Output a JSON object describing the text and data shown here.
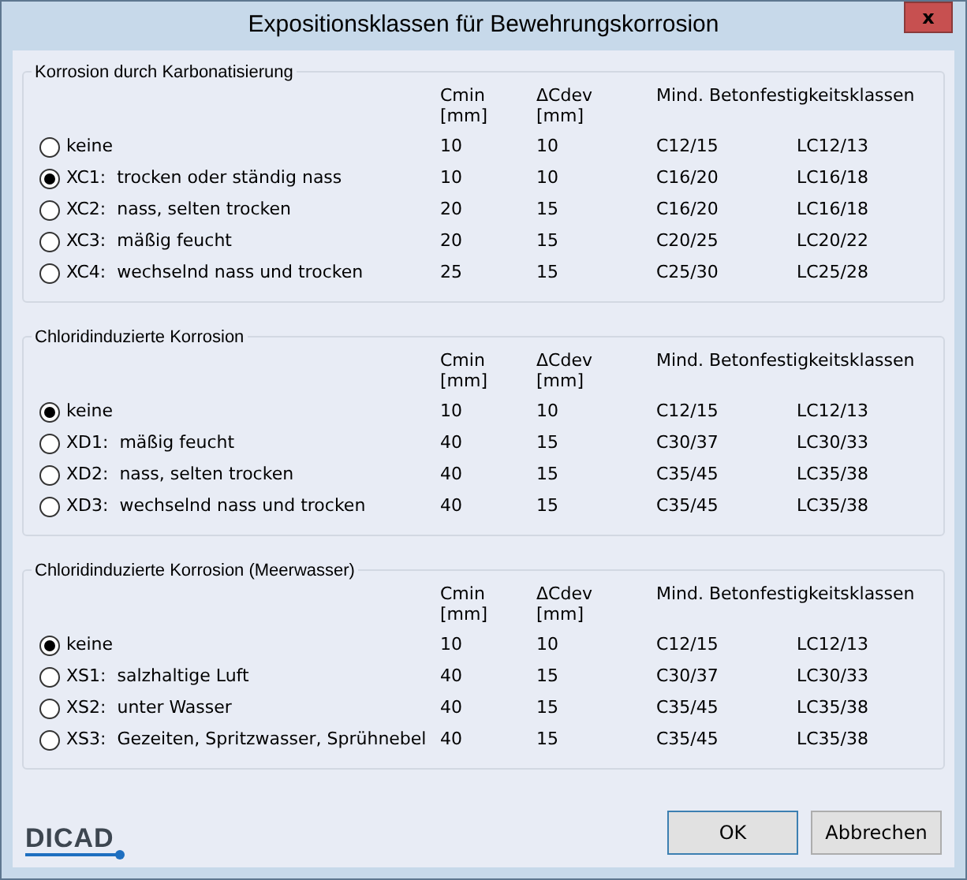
{
  "window": {
    "title": "Expositionsklassen für Bewehrungskorrosion",
    "close": "x"
  },
  "groups": [
    {
      "title": "Korrosion durch Karbonatisierung",
      "columns": [
        {
          "label": "Cmin",
          "unit": "[mm]"
        },
        {
          "label": "ΔCdev",
          "unit": "[mm]"
        },
        {
          "label": "Mind. Betonfestigkeitsklassen"
        }
      ],
      "rows": [
        {
          "label": "keine",
          "selected": false,
          "cmin": "10",
          "dcdev": "10",
          "c_class": "C12/15",
          "lc_class": "LC12/13"
        },
        {
          "label": "XC1:  trocken oder ständig nass",
          "selected": true,
          "cmin": "10",
          "dcdev": "10",
          "c_class": "C16/20",
          "lc_class": "LC16/18"
        },
        {
          "label": "XC2:  nass, selten trocken",
          "selected": false,
          "cmin": "20",
          "dcdev": "15",
          "c_class": "C16/20",
          "lc_class": "LC16/18"
        },
        {
          "label": "XC3:  mäßig feucht",
          "selected": false,
          "cmin": "20",
          "dcdev": "15",
          "c_class": "C20/25",
          "lc_class": "LC20/22"
        },
        {
          "label": "XC4:  wechselnd nass und trocken",
          "selected": false,
          "cmin": "25",
          "dcdev": "15",
          "c_class": "C25/30",
          "lc_class": "LC25/28"
        }
      ]
    },
    {
      "title": "Chloridinduzierte Korrosion",
      "columns": [
        {
          "label": "Cmin",
          "unit": "[mm]"
        },
        {
          "label": "ΔCdev",
          "unit": "[mm]"
        },
        {
          "label": "Mind. Betonfestigkeitsklassen"
        }
      ],
      "rows": [
        {
          "label": "keine",
          "selected": true,
          "cmin": "10",
          "dcdev": "10",
          "c_class": "C12/15",
          "lc_class": "LC12/13"
        },
        {
          "label": "XD1:  mäßig feucht",
          "selected": false,
          "cmin": "40",
          "dcdev": "15",
          "c_class": "C30/37",
          "lc_class": "LC30/33"
        },
        {
          "label": "XD2:  nass, selten trocken",
          "selected": false,
          "cmin": "40",
          "dcdev": "15",
          "c_class": "C35/45",
          "lc_class": "LC35/38"
        },
        {
          "label": "XD3:  wechselnd nass und trocken",
          "selected": false,
          "cmin": "40",
          "dcdev": "15",
          "c_class": "C35/45",
          "lc_class": "LC35/38"
        }
      ]
    },
    {
      "title": "Chloridinduzierte Korrosion (Meerwasser)",
      "columns": [
        {
          "label": "Cmin",
          "unit": "[mm]"
        },
        {
          "label": "ΔCdev",
          "unit": "[mm]"
        },
        {
          "label": "Mind. Betonfestigkeitsklassen"
        }
      ],
      "rows": [
        {
          "label": "keine",
          "selected": true,
          "cmin": "10",
          "dcdev": "10",
          "c_class": "C12/15",
          "lc_class": "LC12/13"
        },
        {
          "label": "XS1:  salzhaltige Luft",
          "selected": false,
          "cmin": "40",
          "dcdev": "15",
          "c_class": "C30/37",
          "lc_class": "LC30/33"
        },
        {
          "label": "XS2:  unter Wasser",
          "selected": false,
          "cmin": "40",
          "dcdev": "15",
          "c_class": "C35/45",
          "lc_class": "LC35/38"
        },
        {
          "label": "XS3:  Gezeiten, Spritzwasser, Sprühnebel",
          "selected": false,
          "cmin": "40",
          "dcdev": "15",
          "c_class": "C35/45",
          "lc_class": "LC35/38"
        }
      ]
    }
  ],
  "logo": "DICAD",
  "buttons": [
    {
      "label": "OK",
      "kind": "default"
    },
    {
      "label": "Abbrechen",
      "kind": "normal"
    }
  ]
}
